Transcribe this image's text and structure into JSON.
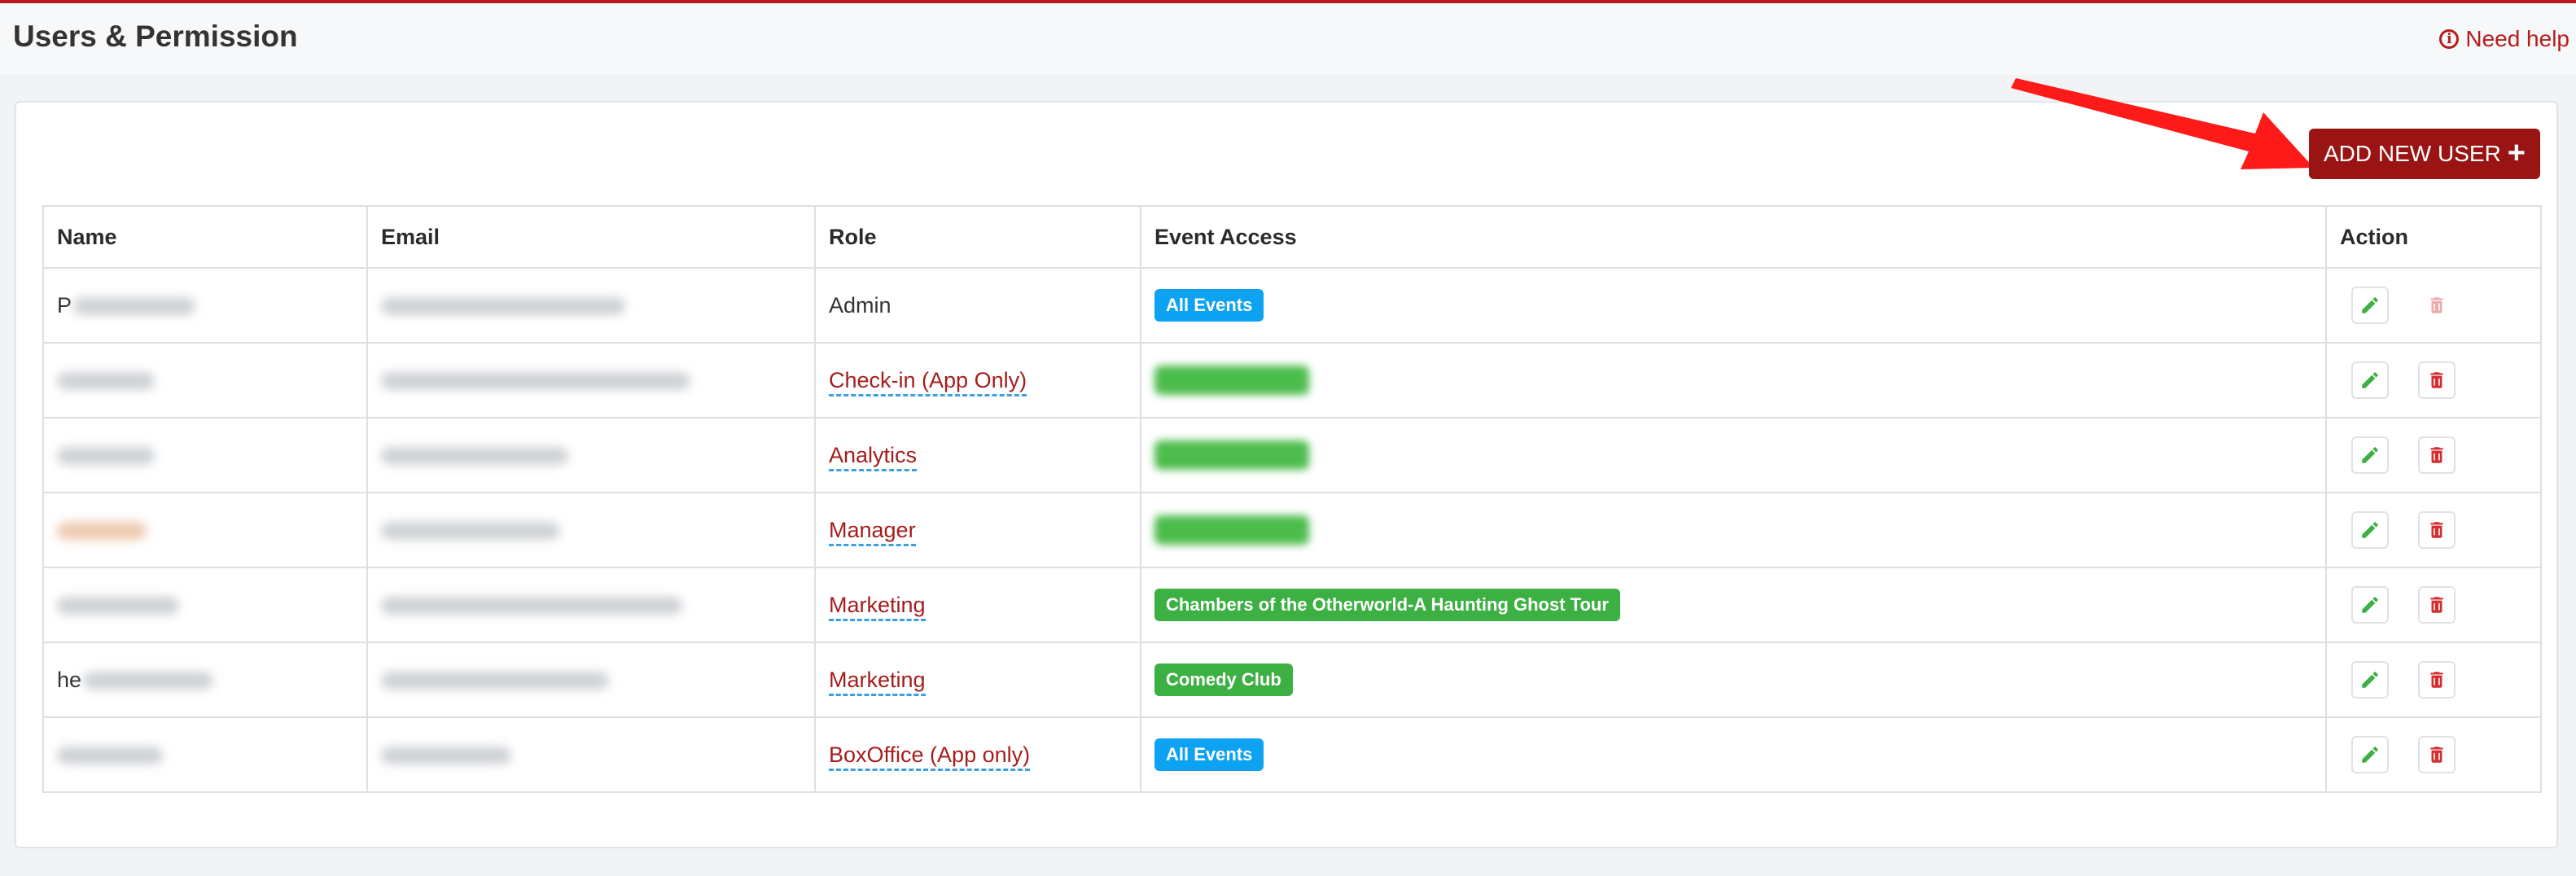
{
  "header": {
    "title": "Users & Permission",
    "help_label": "Need help",
    "help_icon": "info-circle-icon"
  },
  "toolbar": {
    "add_user_label": "ADD NEW USER",
    "add_user_icon": "plus-icon"
  },
  "annotation": {
    "arrow_color": "#ff1a1a"
  },
  "colors": {
    "brand": "#9b1414",
    "link": "#a51d1d",
    "badge_blue": "#0da2f2",
    "badge_green": "#3cb043",
    "edit_icon": "#3cb043",
    "delete_icon": "#d32f2f"
  },
  "table": {
    "columns": [
      "Name",
      "Email",
      "Role",
      "Event Access",
      "Action"
    ],
    "rows": [
      {
        "name_visible": "P",
        "role": "Admin",
        "access": "All Events",
        "delete_enabled": false
      },
      {
        "name_visible": "",
        "role": "Check-in (App Only)",
        "access": "",
        "delete_enabled": true
      },
      {
        "name_visible": "",
        "role": "Analytics",
        "access": "",
        "delete_enabled": true
      },
      {
        "name_visible": "",
        "role": "Manager",
        "access": "",
        "delete_enabled": true
      },
      {
        "name_visible": "",
        "role": "Marketing",
        "access": "Chambers of the Otherworld-A Haunting Ghost Tour",
        "delete_enabled": true
      },
      {
        "name_visible": "he",
        "role": "Marketing",
        "access": "Comedy Club",
        "delete_enabled": true
      },
      {
        "name_visible": "",
        "role": "BoxOffice (App only)",
        "access": "All Events",
        "delete_enabled": true
      }
    ],
    "edit_icon": "pencil-icon",
    "delete_icon": "trash-icon"
  }
}
